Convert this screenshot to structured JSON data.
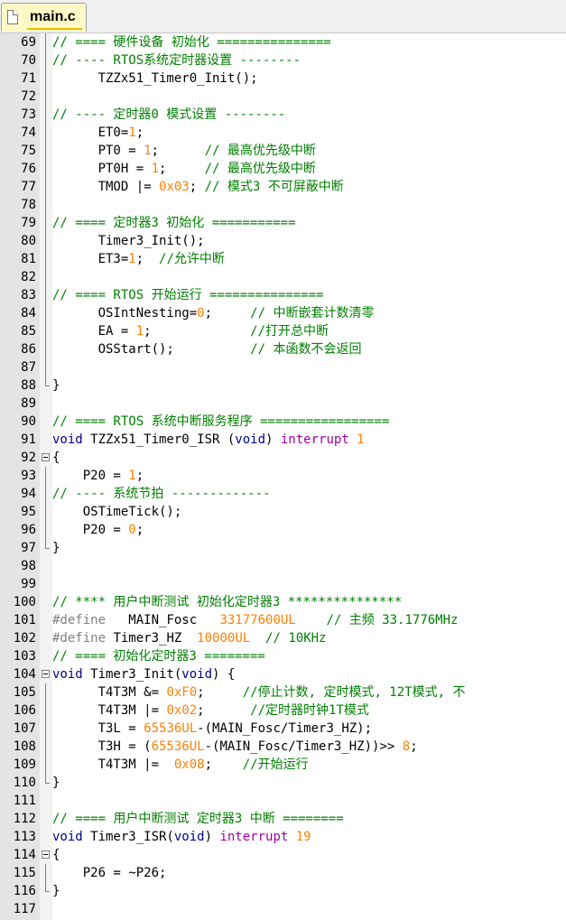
{
  "tab": {
    "filename": "main.c"
  },
  "lines": [
    {
      "n": "69",
      "f": "line",
      "t": [
        {
          "c": "cm",
          "s": "// ==== 硬件设备 初始化 ==============="
        }
      ]
    },
    {
      "n": "70",
      "f": "line",
      "t": [
        {
          "c": "cm",
          "s": "// ---- RTOS系统定时器设置 --------"
        }
      ]
    },
    {
      "n": "71",
      "f": "line",
      "t": [
        {
          "c": "",
          "s": "      TZZx51_Timer0_Init();"
        }
      ]
    },
    {
      "n": "72",
      "f": "line",
      "t": []
    },
    {
      "n": "73",
      "f": "line",
      "t": [
        {
          "c": "cm",
          "s": "// ---- 定时器0 模式设置 --------"
        }
      ]
    },
    {
      "n": "74",
      "f": "line",
      "t": [
        {
          "c": "",
          "s": "      ET0="
        },
        {
          "c": "nm",
          "s": "1"
        },
        {
          "c": "",
          "s": ";"
        }
      ]
    },
    {
      "n": "75",
      "f": "line",
      "t": [
        {
          "c": "",
          "s": "      PT0 = "
        },
        {
          "c": "nm",
          "s": "1"
        },
        {
          "c": "",
          "s": ";      "
        },
        {
          "c": "cm",
          "s": "// 最高优先级中断"
        }
      ]
    },
    {
      "n": "76",
      "f": "line",
      "t": [
        {
          "c": "",
          "s": "      PT0H = "
        },
        {
          "c": "nm",
          "s": "1"
        },
        {
          "c": "",
          "s": ";     "
        },
        {
          "c": "cm",
          "s": "// 最高优先级中断"
        }
      ]
    },
    {
      "n": "77",
      "f": "line",
      "t": [
        {
          "c": "",
          "s": "      TMOD |= "
        },
        {
          "c": "nm",
          "s": "0x03"
        },
        {
          "c": "",
          "s": "; "
        },
        {
          "c": "cm",
          "s": "// 模式3 不可屏蔽中断"
        }
      ]
    },
    {
      "n": "78",
      "f": "line",
      "t": []
    },
    {
      "n": "79",
      "f": "line",
      "t": [
        {
          "c": "cm",
          "s": "// ==== 定时器3 初始化 ==========="
        }
      ]
    },
    {
      "n": "80",
      "f": "line",
      "t": [
        {
          "c": "",
          "s": "      Timer3_Init();"
        }
      ]
    },
    {
      "n": "81",
      "f": "line",
      "t": [
        {
          "c": "",
          "s": "      ET3="
        },
        {
          "c": "nm",
          "s": "1"
        },
        {
          "c": "",
          "s": ";  "
        },
        {
          "c": "cm",
          "s": "//允许中断"
        }
      ]
    },
    {
      "n": "82",
      "f": "line",
      "t": []
    },
    {
      "n": "83",
      "f": "line",
      "t": [
        {
          "c": "cm",
          "s": "// ==== RTOS 开始运行 ==============="
        }
      ]
    },
    {
      "n": "84",
      "f": "line",
      "t": [
        {
          "c": "",
          "s": "      OSIntNesting="
        },
        {
          "c": "nm",
          "s": "0"
        },
        {
          "c": "",
          "s": ";     "
        },
        {
          "c": "cm",
          "s": "// 中断嵌套计数清零"
        }
      ]
    },
    {
      "n": "85",
      "f": "line",
      "t": [
        {
          "c": "",
          "s": "      EA = "
        },
        {
          "c": "nm",
          "s": "1"
        },
        {
          "c": "",
          "s": ";             "
        },
        {
          "c": "cm",
          "s": "//打开总中断"
        }
      ]
    },
    {
      "n": "86",
      "f": "line",
      "t": [
        {
          "c": "",
          "s": "      OSStart();          "
        },
        {
          "c": "cm",
          "s": "// 本函数不会返回"
        }
      ]
    },
    {
      "n": "87",
      "f": "line",
      "t": []
    },
    {
      "n": "88",
      "f": "end",
      "t": [
        {
          "c": "",
          "s": "}"
        }
      ]
    },
    {
      "n": "89",
      "f": "",
      "t": []
    },
    {
      "n": "90",
      "f": "",
      "t": [
        {
          "c": "cm",
          "s": "// ==== RTOS 系统中断服务程序 ================="
        }
      ]
    },
    {
      "n": "91",
      "f": "",
      "t": [
        {
          "c": "kw",
          "s": "void"
        },
        {
          "c": "",
          "s": " TZZx51_Timer0_ISR ("
        },
        {
          "c": "kw",
          "s": "void"
        },
        {
          "c": "",
          "s": ") "
        },
        {
          "c": "in",
          "s": "interrupt"
        },
        {
          "c": "",
          "s": " "
        },
        {
          "c": "nm",
          "s": "1"
        }
      ]
    },
    {
      "n": "92",
      "f": "minus",
      "t": [
        {
          "c": "",
          "s": "{"
        }
      ]
    },
    {
      "n": "93",
      "f": "line",
      "t": [
        {
          "c": "",
          "s": "    P20 = "
        },
        {
          "c": "nm",
          "s": "1"
        },
        {
          "c": "",
          "s": ";"
        }
      ]
    },
    {
      "n": "94",
      "f": "line",
      "t": [
        {
          "c": "cm",
          "s": "// ---- 系统节拍 -------------"
        }
      ]
    },
    {
      "n": "95",
      "f": "line",
      "t": [
        {
          "c": "",
          "s": "    OSTimeTick();"
        }
      ]
    },
    {
      "n": "96",
      "f": "line",
      "t": [
        {
          "c": "",
          "s": "    P20 = "
        },
        {
          "c": "nm",
          "s": "0"
        },
        {
          "c": "",
          "s": ";"
        }
      ]
    },
    {
      "n": "97",
      "f": "end",
      "t": [
        {
          "c": "",
          "s": "}"
        }
      ]
    },
    {
      "n": "98",
      "f": "",
      "t": []
    },
    {
      "n": "99",
      "f": "",
      "t": []
    },
    {
      "n": "100",
      "f": "",
      "t": [
        {
          "c": "cm",
          "s": "// **** 用户中断测试 初始化定时器3 ***************"
        }
      ]
    },
    {
      "n": "101",
      "f": "",
      "t": [
        {
          "c": "pp",
          "s": "#define"
        },
        {
          "c": "",
          "s": "   MAIN_Fosc   "
        },
        {
          "c": "nm",
          "s": "33177600UL"
        },
        {
          "c": "",
          "s": "    "
        },
        {
          "c": "cm",
          "s": "// 主频 33.1776MHz"
        }
      ]
    },
    {
      "n": "102",
      "f": "",
      "t": [
        {
          "c": "pp",
          "s": "#define"
        },
        {
          "c": "",
          "s": " Timer3_HZ  "
        },
        {
          "c": "nm",
          "s": "10000UL"
        },
        {
          "c": "",
          "s": "  "
        },
        {
          "c": "cm",
          "s": "// 10KHz"
        }
      ]
    },
    {
      "n": "103",
      "f": "",
      "t": [
        {
          "c": "cm",
          "s": "// ==== 初始化定时器3 ========"
        }
      ]
    },
    {
      "n": "104",
      "f": "minus",
      "t": [
        {
          "c": "kw",
          "s": "void"
        },
        {
          "c": "",
          "s": " Timer3_Init("
        },
        {
          "c": "kw",
          "s": "void"
        },
        {
          "c": "",
          "s": ") {"
        }
      ]
    },
    {
      "n": "105",
      "f": "line",
      "t": [
        {
          "c": "",
          "s": "      T4T3M &= "
        },
        {
          "c": "nm",
          "s": "0xF0"
        },
        {
          "c": "",
          "s": ";     "
        },
        {
          "c": "cm",
          "s": "//停止计数, 定时模式, 12T模式, 不"
        }
      ]
    },
    {
      "n": "106",
      "f": "line",
      "t": [
        {
          "c": "",
          "s": "      T4T3M |= "
        },
        {
          "c": "nm",
          "s": "0x02"
        },
        {
          "c": "",
          "s": ";      "
        },
        {
          "c": "cm",
          "s": "//定时器时钟1T模式"
        }
      ]
    },
    {
      "n": "107",
      "f": "line",
      "t": [
        {
          "c": "",
          "s": "      T3L = "
        },
        {
          "c": "nm",
          "s": "65536UL"
        },
        {
          "c": "",
          "s": "-(MAIN_Fosc/Timer3_HZ);"
        }
      ]
    },
    {
      "n": "108",
      "f": "line",
      "t": [
        {
          "c": "",
          "s": "      T3H = ("
        },
        {
          "c": "nm",
          "s": "65536UL"
        },
        {
          "c": "",
          "s": "-(MAIN_Fosc/Timer3_HZ))>> "
        },
        {
          "c": "nm",
          "s": "8"
        },
        {
          "c": "",
          "s": ";"
        }
      ]
    },
    {
      "n": "109",
      "f": "line",
      "t": [
        {
          "c": "",
          "s": "      T4T3M |=  "
        },
        {
          "c": "nm",
          "s": "0x08"
        },
        {
          "c": "",
          "s": ";    "
        },
        {
          "c": "cm",
          "s": "//开始运行"
        }
      ]
    },
    {
      "n": "110",
      "f": "end",
      "t": [
        {
          "c": "",
          "s": "}"
        }
      ]
    },
    {
      "n": "111",
      "f": "",
      "t": []
    },
    {
      "n": "112",
      "f": "",
      "t": [
        {
          "c": "cm",
          "s": "// ==== 用户中断测试 定时器3 中断 ========"
        }
      ]
    },
    {
      "n": "113",
      "f": "",
      "t": [
        {
          "c": "kw",
          "s": "void"
        },
        {
          "c": "",
          "s": " Timer3_ISR("
        },
        {
          "c": "kw",
          "s": "void"
        },
        {
          "c": "",
          "s": ") "
        },
        {
          "c": "in",
          "s": "interrupt"
        },
        {
          "c": "",
          "s": " "
        },
        {
          "c": "nm",
          "s": "19"
        }
      ]
    },
    {
      "n": "114",
      "f": "minus",
      "t": [
        {
          "c": "",
          "s": "{"
        }
      ]
    },
    {
      "n": "115",
      "f": "line",
      "t": [
        {
          "c": "",
          "s": "    P26 = ~P26;"
        }
      ]
    },
    {
      "n": "116",
      "f": "end",
      "t": [
        {
          "c": "",
          "s": "}"
        }
      ]
    },
    {
      "n": "117",
      "f": "",
      "t": []
    }
  ]
}
